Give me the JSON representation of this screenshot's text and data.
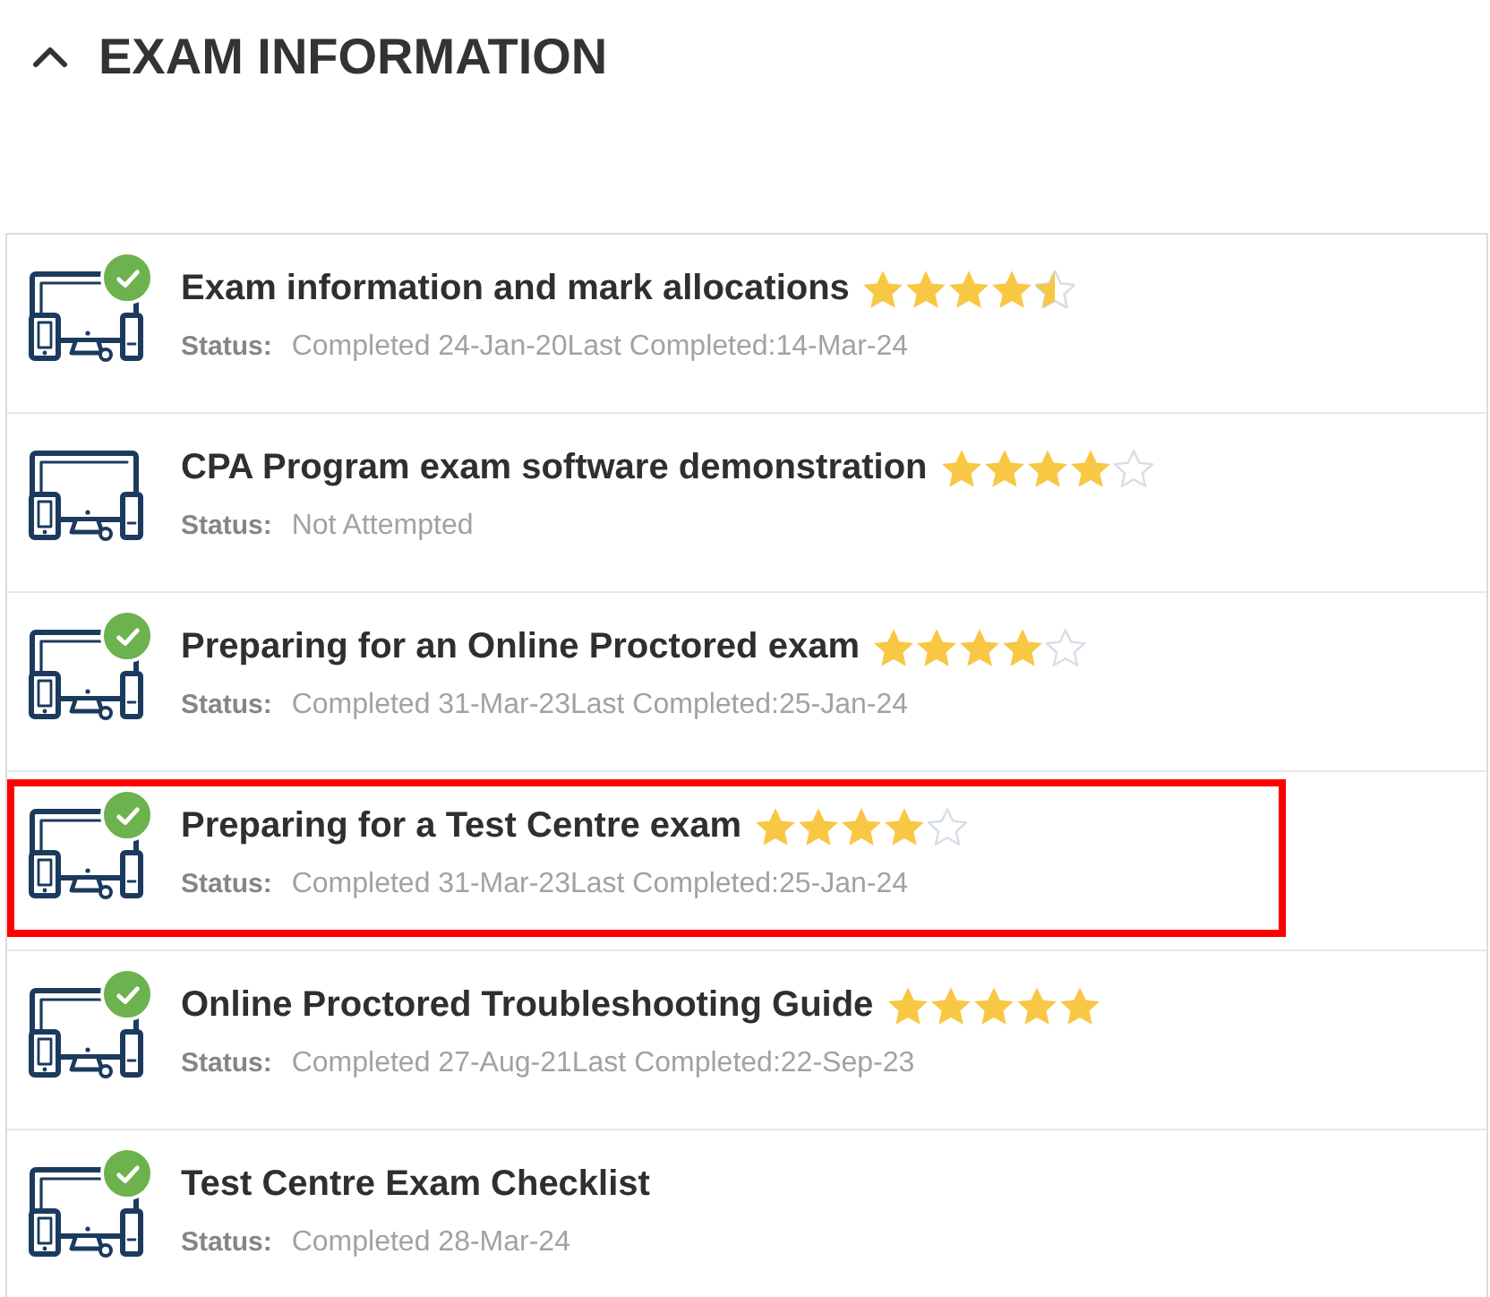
{
  "section": {
    "title": "EXAM INFORMATION",
    "expanded": true
  },
  "rows": [
    {
      "title": "Exam information and mark allocations",
      "stars": 4.5,
      "status_label": "Status:",
      "status": "Completed 24-Jan-20Last Completed:14-Mar-24",
      "completed": true,
      "highlighted": false
    },
    {
      "title": "CPA Program exam software demonstration",
      "stars": 4,
      "status_label": "Status:",
      "status": "Not Attempted",
      "completed": false,
      "highlighted": false
    },
    {
      "title": "Preparing for an Online Proctored exam",
      "stars": 4,
      "status_label": "Status:",
      "status": "Completed 31-Mar-23Last Completed:25-Jan-24",
      "completed": true,
      "highlighted": false
    },
    {
      "title": "Preparing for a Test Centre exam",
      "stars": 4,
      "status_label": "Status:",
      "status": "Completed 31-Mar-23Last Completed:25-Jan-24",
      "completed": true,
      "highlighted": true
    },
    {
      "title": "Online Proctored Troubleshooting Guide",
      "stars": 5,
      "status_label": "Status:",
      "status": "Completed 27-Aug-21Last Completed:22-Sep-23",
      "completed": true,
      "highlighted": false
    },
    {
      "title": "Test Centre Exam Checklist",
      "status_label": "Status:",
      "status": "Completed 28-Mar-24",
      "completed": true,
      "highlighted": false
    }
  ]
}
